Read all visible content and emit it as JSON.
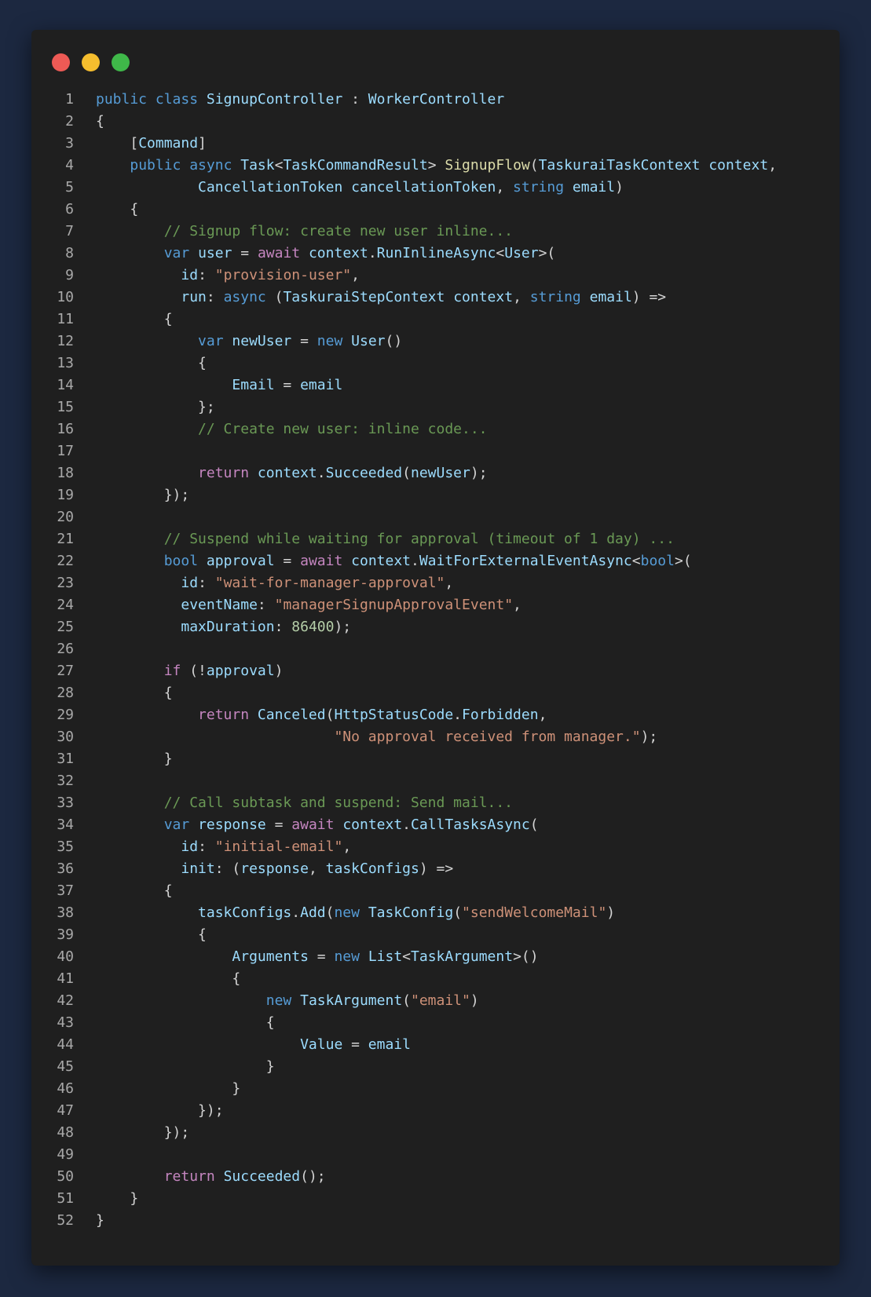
{
  "window": {
    "controls": [
      {
        "name": "close",
        "color": "#ed5a55"
      },
      {
        "name": "minimize",
        "color": "#f5bd2e"
      },
      {
        "name": "maximize",
        "color": "#3fb849"
      }
    ]
  },
  "colors": {
    "keyword": "#569cd6",
    "control": "#c586c0",
    "type": "#9cdcfe",
    "function": "#dcdcaa",
    "string": "#ce9178",
    "comment": "#6a9955",
    "number": "#b5cea8",
    "plain": "#d4d4d4"
  },
  "code": {
    "lines": [
      [
        [
          "kw",
          "public class "
        ],
        [
          "tp",
          "SignupController"
        ],
        [
          "pl",
          " : "
        ],
        [
          "tp",
          "WorkerController"
        ]
      ],
      [
        [
          "pl",
          "{"
        ]
      ],
      [
        [
          "pl",
          "    ["
        ],
        [
          "tp",
          "Command"
        ],
        [
          "pl",
          "]"
        ]
      ],
      [
        [
          "pl",
          "    "
        ],
        [
          "kw",
          "public async "
        ],
        [
          "tp",
          "Task"
        ],
        [
          "pl",
          "<"
        ],
        [
          "tp",
          "TaskCommandResult"
        ],
        [
          "pl",
          "> "
        ],
        [
          "fn",
          "SignupFlow"
        ],
        [
          "pl",
          "("
        ],
        [
          "tp",
          "TaskuraiTaskContext context"
        ],
        [
          "pl",
          ","
        ]
      ],
      [
        [
          "pl",
          "            "
        ],
        [
          "tp",
          "CancellationToken cancellationToken"
        ],
        [
          "pl",
          ", "
        ],
        [
          "kw",
          "string "
        ],
        [
          "tp",
          "email"
        ],
        [
          "pl",
          ")"
        ]
      ],
      [
        [
          "pl",
          "    {"
        ]
      ],
      [
        [
          "pl",
          "        "
        ],
        [
          "com",
          "// Signup flow: create new user inline..."
        ]
      ],
      [
        [
          "pl",
          "        "
        ],
        [
          "kw",
          "var "
        ],
        [
          "tp",
          "user"
        ],
        [
          "pl",
          " = "
        ],
        [
          "ctl",
          "await "
        ],
        [
          "tp",
          "context"
        ],
        [
          "pl",
          "."
        ],
        [
          "tp",
          "RunInlineAsync"
        ],
        [
          "pl",
          "<"
        ],
        [
          "tp",
          "User"
        ],
        [
          "pl",
          ">("
        ]
      ],
      [
        [
          "pl",
          "          "
        ],
        [
          "tp",
          "id"
        ],
        [
          "pl",
          ": "
        ],
        [
          "str",
          "\"provision-user\""
        ],
        [
          "pl",
          ","
        ]
      ],
      [
        [
          "pl",
          "          "
        ],
        [
          "tp",
          "run"
        ],
        [
          "pl",
          ": "
        ],
        [
          "kw",
          "async "
        ],
        [
          "pl",
          "("
        ],
        [
          "tp",
          "TaskuraiStepContext context"
        ],
        [
          "pl",
          ", "
        ],
        [
          "kw",
          "string "
        ],
        [
          "tp",
          "email"
        ],
        [
          "pl",
          ") =>"
        ]
      ],
      [
        [
          "pl",
          "        {"
        ]
      ],
      [
        [
          "pl",
          "            "
        ],
        [
          "kw",
          "var "
        ],
        [
          "tp",
          "newUser"
        ],
        [
          "pl",
          " = "
        ],
        [
          "kw",
          "new "
        ],
        [
          "tp",
          "User"
        ],
        [
          "pl",
          "()"
        ]
      ],
      [
        [
          "pl",
          "            {"
        ]
      ],
      [
        [
          "pl",
          "                "
        ],
        [
          "tp",
          "Email"
        ],
        [
          "pl",
          " = "
        ],
        [
          "tp",
          "email"
        ]
      ],
      [
        [
          "pl",
          "            };"
        ]
      ],
      [
        [
          "pl",
          "            "
        ],
        [
          "com",
          "// Create new user: inline code..."
        ]
      ],
      [],
      [
        [
          "pl",
          "            "
        ],
        [
          "ctl",
          "return "
        ],
        [
          "tp",
          "context"
        ],
        [
          "pl",
          "."
        ],
        [
          "tp",
          "Succeeded"
        ],
        [
          "pl",
          "("
        ],
        [
          "tp",
          "newUser"
        ],
        [
          "pl",
          ");"
        ]
      ],
      [
        [
          "pl",
          "        });"
        ]
      ],
      [],
      [
        [
          "pl",
          "        "
        ],
        [
          "com",
          "// Suspend while waiting for approval (timeout of 1 day) ..."
        ]
      ],
      [
        [
          "pl",
          "        "
        ],
        [
          "kw",
          "bool "
        ],
        [
          "tp",
          "approval"
        ],
        [
          "pl",
          " = "
        ],
        [
          "ctl",
          "await "
        ],
        [
          "tp",
          "context"
        ],
        [
          "pl",
          "."
        ],
        [
          "tp",
          "WaitForExternalEventAsync"
        ],
        [
          "pl",
          "<"
        ],
        [
          "kw",
          "bool"
        ],
        [
          "pl",
          ">("
        ]
      ],
      [
        [
          "pl",
          "          "
        ],
        [
          "tp",
          "id"
        ],
        [
          "pl",
          ": "
        ],
        [
          "str",
          "\"wait-for-manager-approval\""
        ],
        [
          "pl",
          ","
        ]
      ],
      [
        [
          "pl",
          "          "
        ],
        [
          "tp",
          "eventName"
        ],
        [
          "pl",
          ": "
        ],
        [
          "str",
          "\"managerSignupApprovalEvent\""
        ],
        [
          "pl",
          ","
        ]
      ],
      [
        [
          "pl",
          "          "
        ],
        [
          "tp",
          "maxDuration"
        ],
        [
          "pl",
          ": "
        ],
        [
          "num",
          "86400"
        ],
        [
          "pl",
          ");"
        ]
      ],
      [],
      [
        [
          "pl",
          "        "
        ],
        [
          "ctl",
          "if "
        ],
        [
          "pl",
          "(!"
        ],
        [
          "tp",
          "approval"
        ],
        [
          "pl",
          ")"
        ]
      ],
      [
        [
          "pl",
          "        {"
        ]
      ],
      [
        [
          "pl",
          "            "
        ],
        [
          "ctl",
          "return "
        ],
        [
          "tp",
          "Canceled"
        ],
        [
          "pl",
          "("
        ],
        [
          "tp",
          "HttpStatusCode"
        ],
        [
          "pl",
          "."
        ],
        [
          "tp",
          "Forbidden"
        ],
        [
          "pl",
          ","
        ]
      ],
      [
        [
          "pl",
          "                            "
        ],
        [
          "str",
          "\"No approval received from manager.\""
        ],
        [
          "pl",
          ");"
        ]
      ],
      [
        [
          "pl",
          "        }"
        ]
      ],
      [],
      [
        [
          "pl",
          "        "
        ],
        [
          "com",
          "// Call subtask and suspend: Send mail..."
        ]
      ],
      [
        [
          "pl",
          "        "
        ],
        [
          "kw",
          "var "
        ],
        [
          "tp",
          "response"
        ],
        [
          "pl",
          " = "
        ],
        [
          "ctl",
          "await "
        ],
        [
          "tp",
          "context"
        ],
        [
          "pl",
          "."
        ],
        [
          "tp",
          "CallTasksAsync"
        ],
        [
          "pl",
          "("
        ]
      ],
      [
        [
          "pl",
          "          "
        ],
        [
          "tp",
          "id"
        ],
        [
          "pl",
          ": "
        ],
        [
          "str",
          "\"initial-email\""
        ],
        [
          "pl",
          ","
        ]
      ],
      [
        [
          "pl",
          "          "
        ],
        [
          "tp",
          "init"
        ],
        [
          "pl",
          ": ("
        ],
        [
          "tp",
          "response"
        ],
        [
          "pl",
          ", "
        ],
        [
          "tp",
          "taskConfigs"
        ],
        [
          "pl",
          ") =>"
        ]
      ],
      [
        [
          "pl",
          "        {"
        ]
      ],
      [
        [
          "pl",
          "            "
        ],
        [
          "tp",
          "taskConfigs"
        ],
        [
          "pl",
          "."
        ],
        [
          "tp",
          "Add"
        ],
        [
          "pl",
          "("
        ],
        [
          "kw",
          "new "
        ],
        [
          "tp",
          "TaskConfig"
        ],
        [
          "pl",
          "("
        ],
        [
          "str",
          "\"sendWelcomeMail\""
        ],
        [
          "pl",
          ")"
        ]
      ],
      [
        [
          "pl",
          "            {"
        ]
      ],
      [
        [
          "pl",
          "                "
        ],
        [
          "tp",
          "Arguments"
        ],
        [
          "pl",
          " = "
        ],
        [
          "kw",
          "new "
        ],
        [
          "tp",
          "List"
        ],
        [
          "pl",
          "<"
        ],
        [
          "tp",
          "TaskArgument"
        ],
        [
          "pl",
          ">()"
        ]
      ],
      [
        [
          "pl",
          "                {"
        ]
      ],
      [
        [
          "pl",
          "                    "
        ],
        [
          "kw",
          "new "
        ],
        [
          "tp",
          "TaskArgument"
        ],
        [
          "pl",
          "("
        ],
        [
          "str",
          "\"email\""
        ],
        [
          "pl",
          ")"
        ]
      ],
      [
        [
          "pl",
          "                    {"
        ]
      ],
      [
        [
          "pl",
          "                        "
        ],
        [
          "tp",
          "Value"
        ],
        [
          "pl",
          " = "
        ],
        [
          "tp",
          "email"
        ]
      ],
      [
        [
          "pl",
          "                    }"
        ]
      ],
      [
        [
          "pl",
          "                }"
        ]
      ],
      [
        [
          "pl",
          "            });"
        ]
      ],
      [
        [
          "pl",
          "        });"
        ]
      ],
      [],
      [
        [
          "pl",
          "        "
        ],
        [
          "ctl",
          "return "
        ],
        [
          "tp",
          "Succeeded"
        ],
        [
          "pl",
          "();"
        ]
      ],
      [
        [
          "pl",
          "    }"
        ]
      ],
      [
        [
          "pl",
          "}"
        ]
      ]
    ]
  }
}
